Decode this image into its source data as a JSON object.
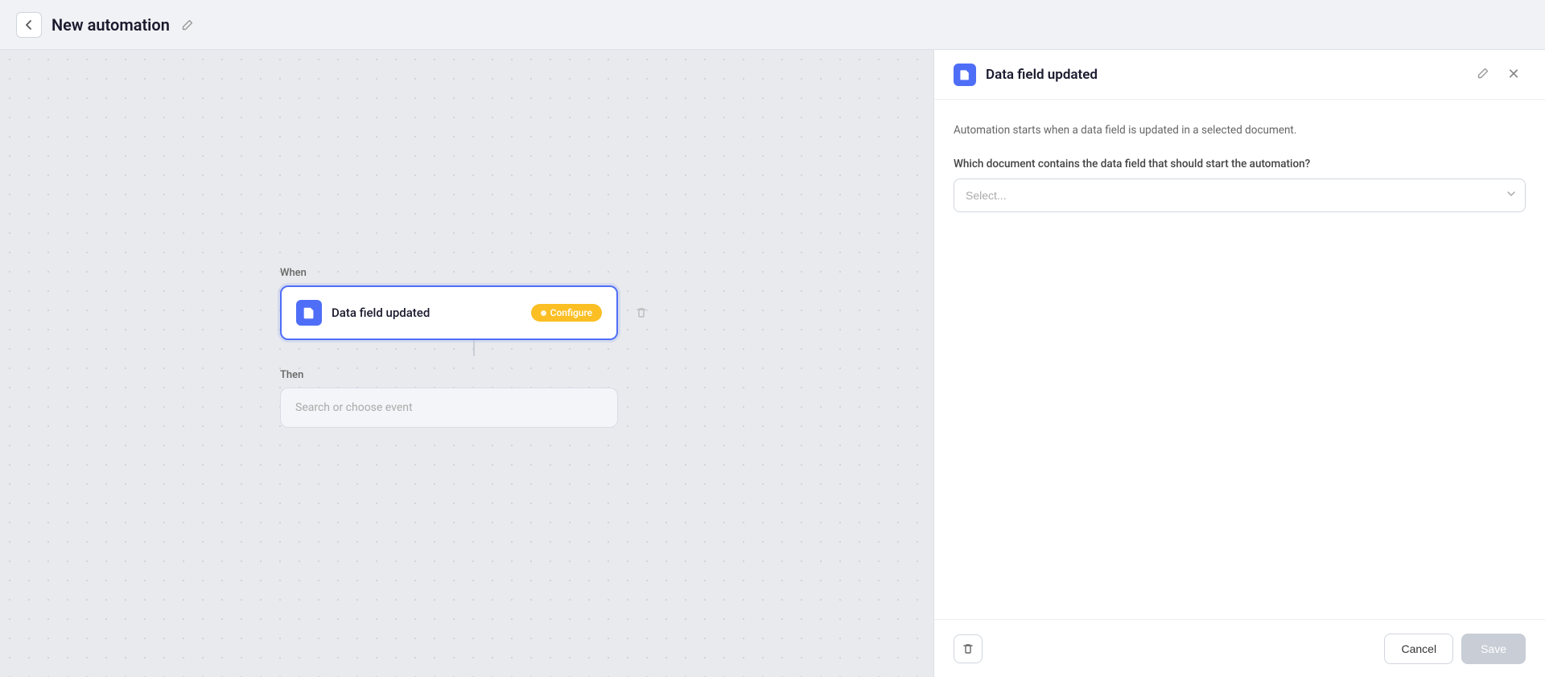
{
  "topbar": {
    "title": "New automation",
    "back_label": "←",
    "edit_icon": "✏"
  },
  "left_panel": {
    "when_label": "When",
    "then_label": "Then",
    "trigger_card": {
      "label": "Data field updated",
      "configure_label": "Configure",
      "icon_alt": "document-icon"
    },
    "action_card": {
      "placeholder": "Search or choose event"
    }
  },
  "right_panel": {
    "header": {
      "title": "Data field updated",
      "edit_icon": "✏",
      "close_icon": "✕"
    },
    "description": "Automation starts when a data field is updated in a selected document.",
    "question": "Which document contains the data field that should start the automation?",
    "select_placeholder": "Select...",
    "footer": {
      "delete_icon": "🗑",
      "cancel_label": "Cancel",
      "save_label": "Save"
    }
  }
}
